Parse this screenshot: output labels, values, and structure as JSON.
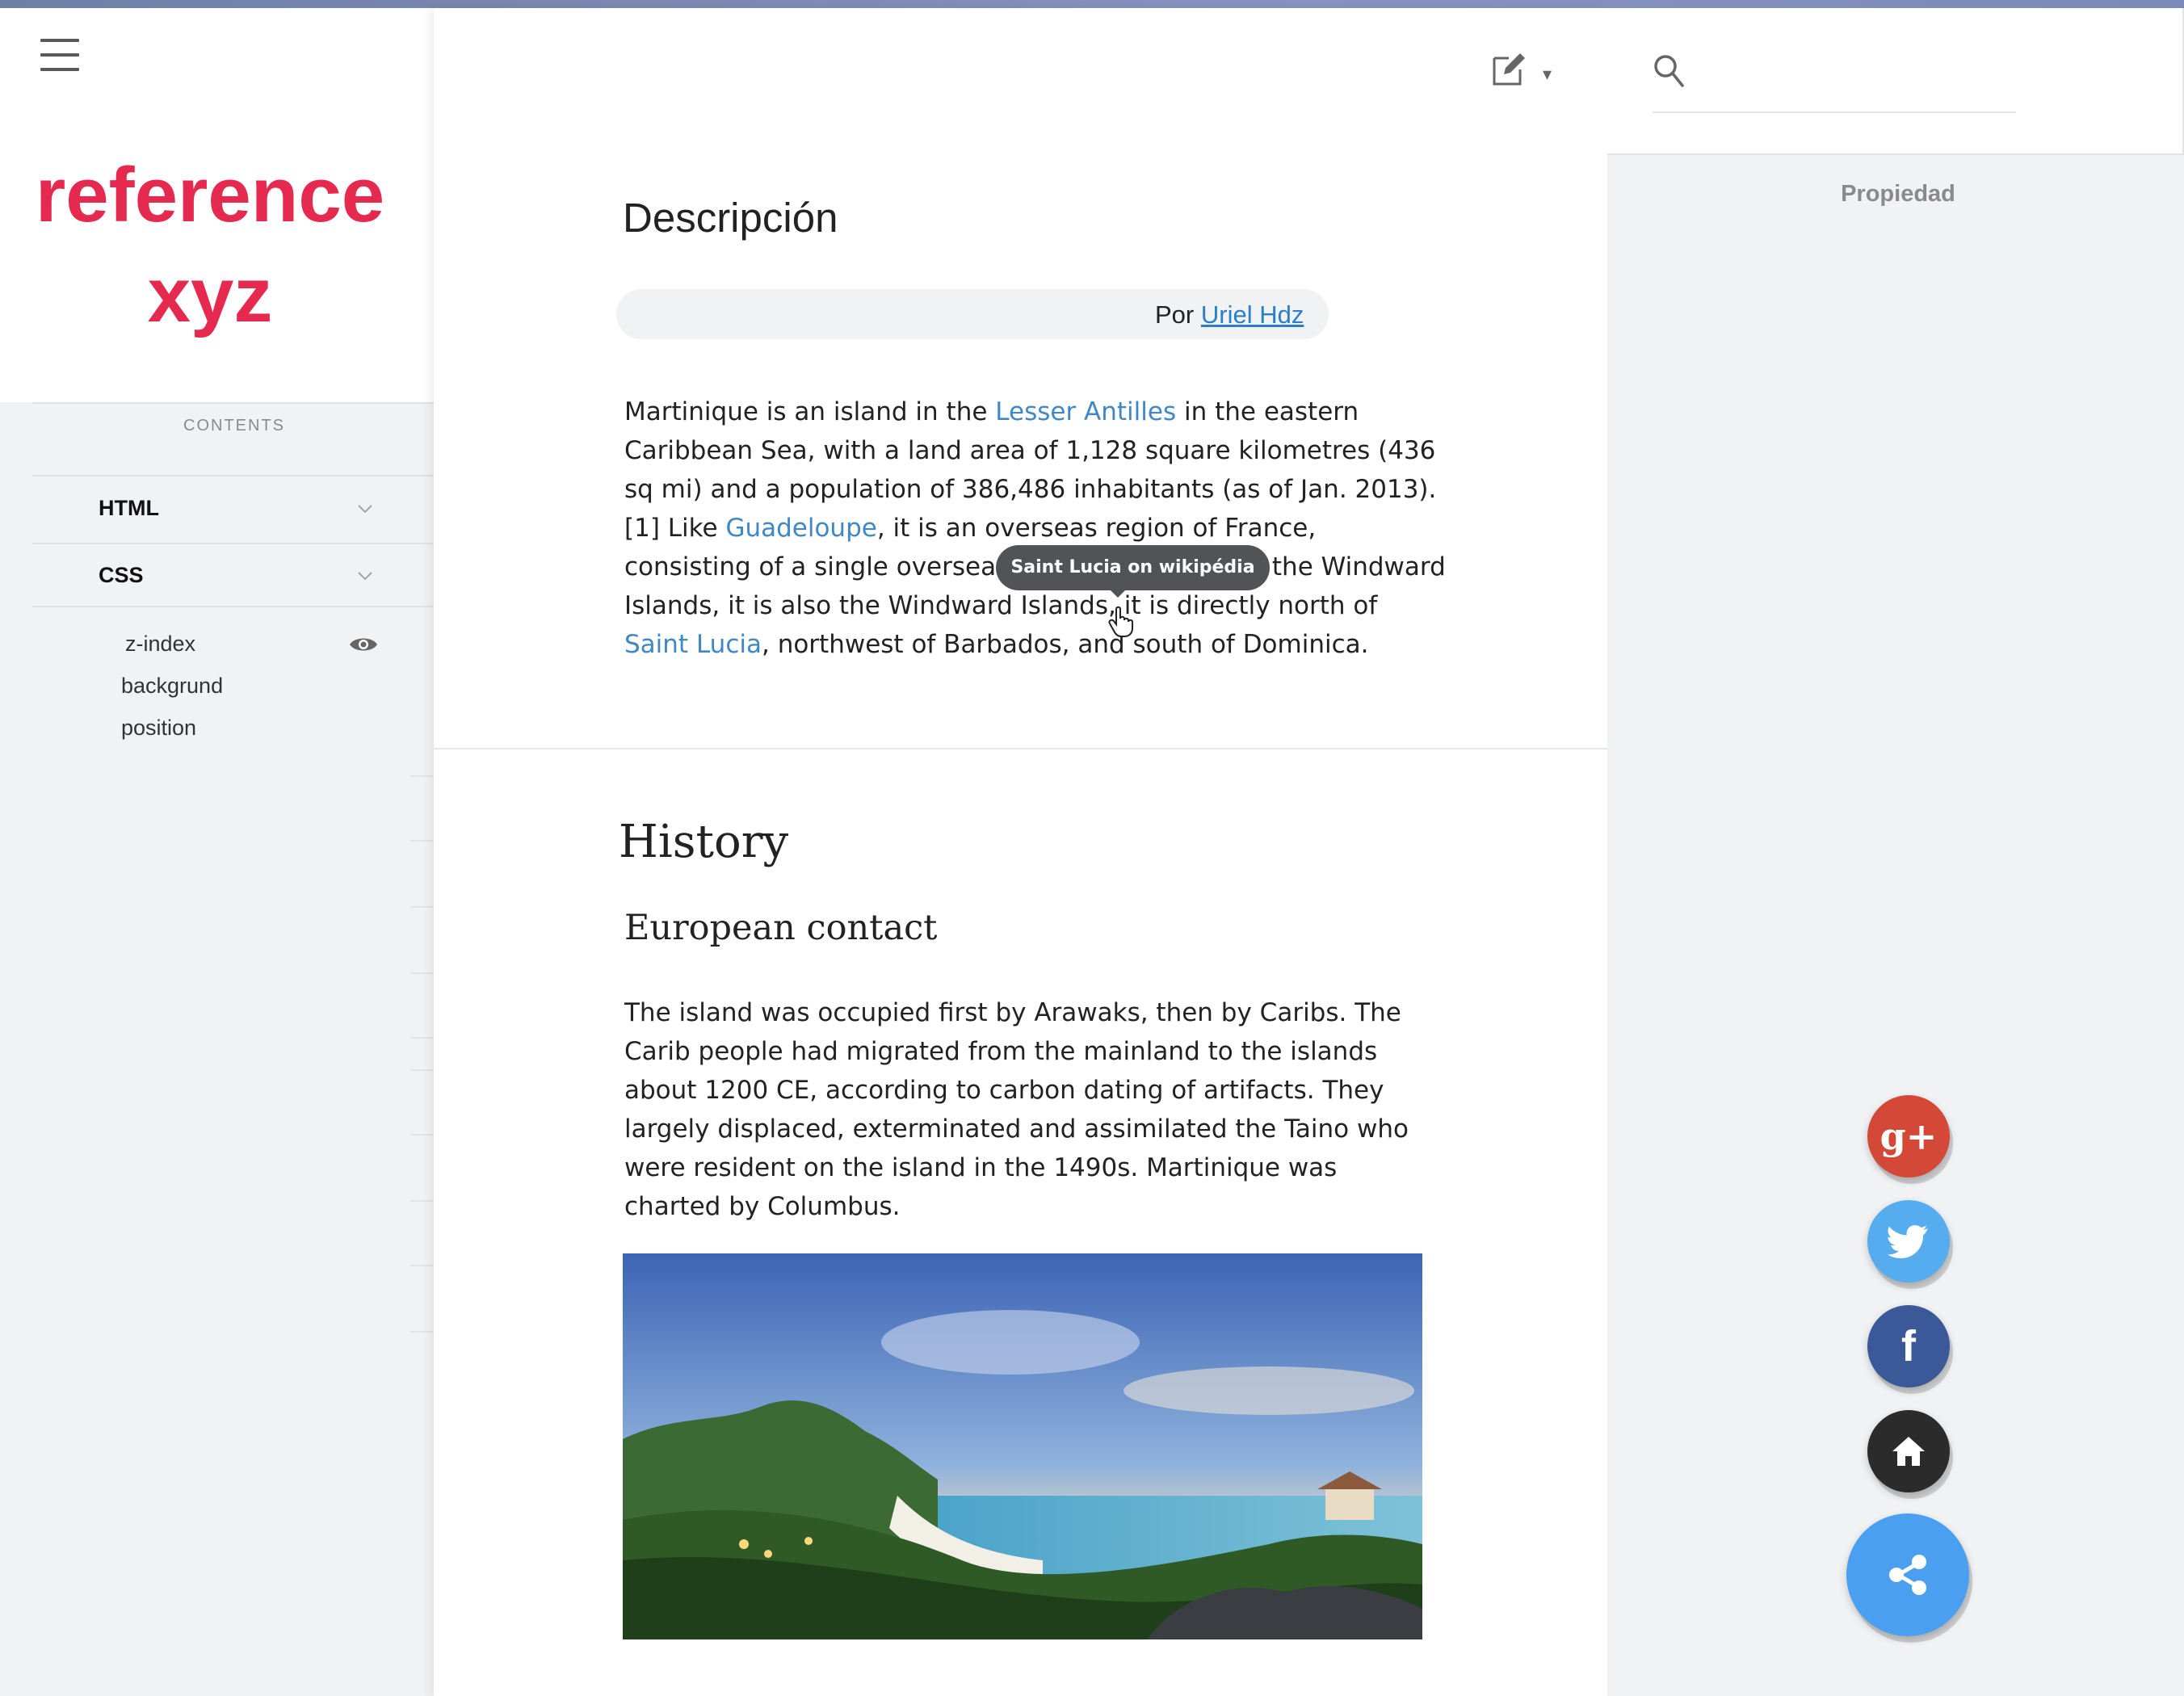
{
  "brand": {
    "logo_line1": "reference",
    "logo_line2": "xyz"
  },
  "sidebar": {
    "contents_label": "CONTENTS",
    "sections": [
      {
        "label": "HTML",
        "icon": "chevron-down-icon"
      },
      {
        "label": "CSS",
        "icon": "chevron-down-icon"
      }
    ],
    "css_children": [
      "z-index",
      "backgrund",
      "position"
    ],
    "active_item_icon": "eye-icon"
  },
  "toolbar": {
    "edit_icon": "edit-icon",
    "caret": "▾"
  },
  "article": {
    "description_heading": "Descripción",
    "author_prefix": "Por",
    "author_name": "Uriel Hdz",
    "paragraph1": {
      "t1": "Martinique is an island in the ",
      "link1": "Lesser Antilles",
      "t2": " in the eastern Caribbean Sea, with a land area of 1,128 square kilometres (436 sq mi) and a population of 386,486 inhabitants (as of Jan. 2013).[1] Like ",
      "link2": "Guadeloupe",
      "t3": ", it is an overseas region of France, consisting of a single overseas department. One of the Windward Islands, it is also the Windward Islands, it is directly north of ",
      "link3": "Saint Lucia",
      "t4": ", northwest of Barbados, and south of Dominica."
    },
    "tooltip": "Saint Lucia on wikipédia",
    "history_heading": "History",
    "subheading": "European contact",
    "paragraph2": "The island was occupied first by Arawaks, then by Caribs. The Carib people had migrated from the mainland to the islands about 1200 CE, according to carbon dating of artifacts. They largely displaced, exterminated and assimilated the Taino who were resident on the island in the 1490s. Martinique was charted by Columbus."
  },
  "right_panel": {
    "search_placeholder": "",
    "property_label": "Propiedad"
  },
  "share": {
    "buttons": [
      {
        "name": "google-plus",
        "glyph": "g+",
        "color": "#d34836"
      },
      {
        "name": "twitter",
        "glyph": "twitter-bird",
        "color": "#55acee"
      },
      {
        "name": "facebook",
        "glyph": "f",
        "color": "#3b5998"
      },
      {
        "name": "home",
        "glyph": "house",
        "color": "#2b2b2b"
      },
      {
        "name": "share",
        "glyph": "share-nodes",
        "color": "#4a9ff0"
      }
    ]
  },
  "colors": {
    "accent": "#e5294f",
    "link": "#3f88c5",
    "tooltip_bg": "#525356"
  }
}
